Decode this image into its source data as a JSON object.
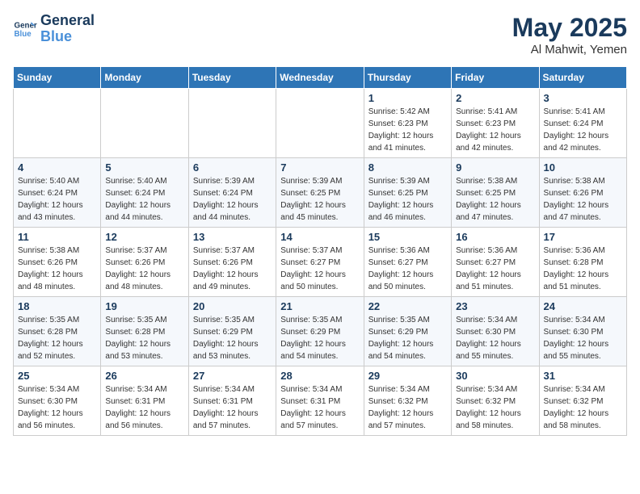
{
  "header": {
    "logo_line1": "General",
    "logo_line2": "Blue",
    "month_year": "May 2025",
    "location": "Al Mahwit, Yemen"
  },
  "weekdays": [
    "Sunday",
    "Monday",
    "Tuesday",
    "Wednesday",
    "Thursday",
    "Friday",
    "Saturday"
  ],
  "weeks": [
    [
      {
        "day": "",
        "sunrise": "",
        "sunset": "",
        "daylight": ""
      },
      {
        "day": "",
        "sunrise": "",
        "sunset": "",
        "daylight": ""
      },
      {
        "day": "",
        "sunrise": "",
        "sunset": "",
        "daylight": ""
      },
      {
        "day": "",
        "sunrise": "",
        "sunset": "",
        "daylight": ""
      },
      {
        "day": "1",
        "sunrise": "5:42 AM",
        "sunset": "6:23 PM",
        "daylight": "12 hours and 41 minutes."
      },
      {
        "day": "2",
        "sunrise": "5:41 AM",
        "sunset": "6:23 PM",
        "daylight": "12 hours and 42 minutes."
      },
      {
        "day": "3",
        "sunrise": "5:41 AM",
        "sunset": "6:24 PM",
        "daylight": "12 hours and 42 minutes."
      }
    ],
    [
      {
        "day": "4",
        "sunrise": "5:40 AM",
        "sunset": "6:24 PM",
        "daylight": "12 hours and 43 minutes."
      },
      {
        "day": "5",
        "sunrise": "5:40 AM",
        "sunset": "6:24 PM",
        "daylight": "12 hours and 44 minutes."
      },
      {
        "day": "6",
        "sunrise": "5:39 AM",
        "sunset": "6:24 PM",
        "daylight": "12 hours and 44 minutes."
      },
      {
        "day": "7",
        "sunrise": "5:39 AM",
        "sunset": "6:25 PM",
        "daylight": "12 hours and 45 minutes."
      },
      {
        "day": "8",
        "sunrise": "5:39 AM",
        "sunset": "6:25 PM",
        "daylight": "12 hours and 46 minutes."
      },
      {
        "day": "9",
        "sunrise": "5:38 AM",
        "sunset": "6:25 PM",
        "daylight": "12 hours and 47 minutes."
      },
      {
        "day": "10",
        "sunrise": "5:38 AM",
        "sunset": "6:26 PM",
        "daylight": "12 hours and 47 minutes."
      }
    ],
    [
      {
        "day": "11",
        "sunrise": "5:38 AM",
        "sunset": "6:26 PM",
        "daylight": "12 hours and 48 minutes."
      },
      {
        "day": "12",
        "sunrise": "5:37 AM",
        "sunset": "6:26 PM",
        "daylight": "12 hours and 48 minutes."
      },
      {
        "day": "13",
        "sunrise": "5:37 AM",
        "sunset": "6:26 PM",
        "daylight": "12 hours and 49 minutes."
      },
      {
        "day": "14",
        "sunrise": "5:37 AM",
        "sunset": "6:27 PM",
        "daylight": "12 hours and 50 minutes."
      },
      {
        "day": "15",
        "sunrise": "5:36 AM",
        "sunset": "6:27 PM",
        "daylight": "12 hours and 50 minutes."
      },
      {
        "day": "16",
        "sunrise": "5:36 AM",
        "sunset": "6:27 PM",
        "daylight": "12 hours and 51 minutes."
      },
      {
        "day": "17",
        "sunrise": "5:36 AM",
        "sunset": "6:28 PM",
        "daylight": "12 hours and 51 minutes."
      }
    ],
    [
      {
        "day": "18",
        "sunrise": "5:35 AM",
        "sunset": "6:28 PM",
        "daylight": "12 hours and 52 minutes."
      },
      {
        "day": "19",
        "sunrise": "5:35 AM",
        "sunset": "6:28 PM",
        "daylight": "12 hours and 53 minutes."
      },
      {
        "day": "20",
        "sunrise": "5:35 AM",
        "sunset": "6:29 PM",
        "daylight": "12 hours and 53 minutes."
      },
      {
        "day": "21",
        "sunrise": "5:35 AM",
        "sunset": "6:29 PM",
        "daylight": "12 hours and 54 minutes."
      },
      {
        "day": "22",
        "sunrise": "5:35 AM",
        "sunset": "6:29 PM",
        "daylight": "12 hours and 54 minutes."
      },
      {
        "day": "23",
        "sunrise": "5:34 AM",
        "sunset": "6:30 PM",
        "daylight": "12 hours and 55 minutes."
      },
      {
        "day": "24",
        "sunrise": "5:34 AM",
        "sunset": "6:30 PM",
        "daylight": "12 hours and 55 minutes."
      }
    ],
    [
      {
        "day": "25",
        "sunrise": "5:34 AM",
        "sunset": "6:30 PM",
        "daylight": "12 hours and 56 minutes."
      },
      {
        "day": "26",
        "sunrise": "5:34 AM",
        "sunset": "6:31 PM",
        "daylight": "12 hours and 56 minutes."
      },
      {
        "day": "27",
        "sunrise": "5:34 AM",
        "sunset": "6:31 PM",
        "daylight": "12 hours and 57 minutes."
      },
      {
        "day": "28",
        "sunrise": "5:34 AM",
        "sunset": "6:31 PM",
        "daylight": "12 hours and 57 minutes."
      },
      {
        "day": "29",
        "sunrise": "5:34 AM",
        "sunset": "6:32 PM",
        "daylight": "12 hours and 57 minutes."
      },
      {
        "day": "30",
        "sunrise": "5:34 AM",
        "sunset": "6:32 PM",
        "daylight": "12 hours and 58 minutes."
      },
      {
        "day": "31",
        "sunrise": "5:34 AM",
        "sunset": "6:32 PM",
        "daylight": "12 hours and 58 minutes."
      }
    ]
  ],
  "labels": {
    "sunrise": "Sunrise:",
    "sunset": "Sunset:",
    "daylight": "Daylight:"
  }
}
